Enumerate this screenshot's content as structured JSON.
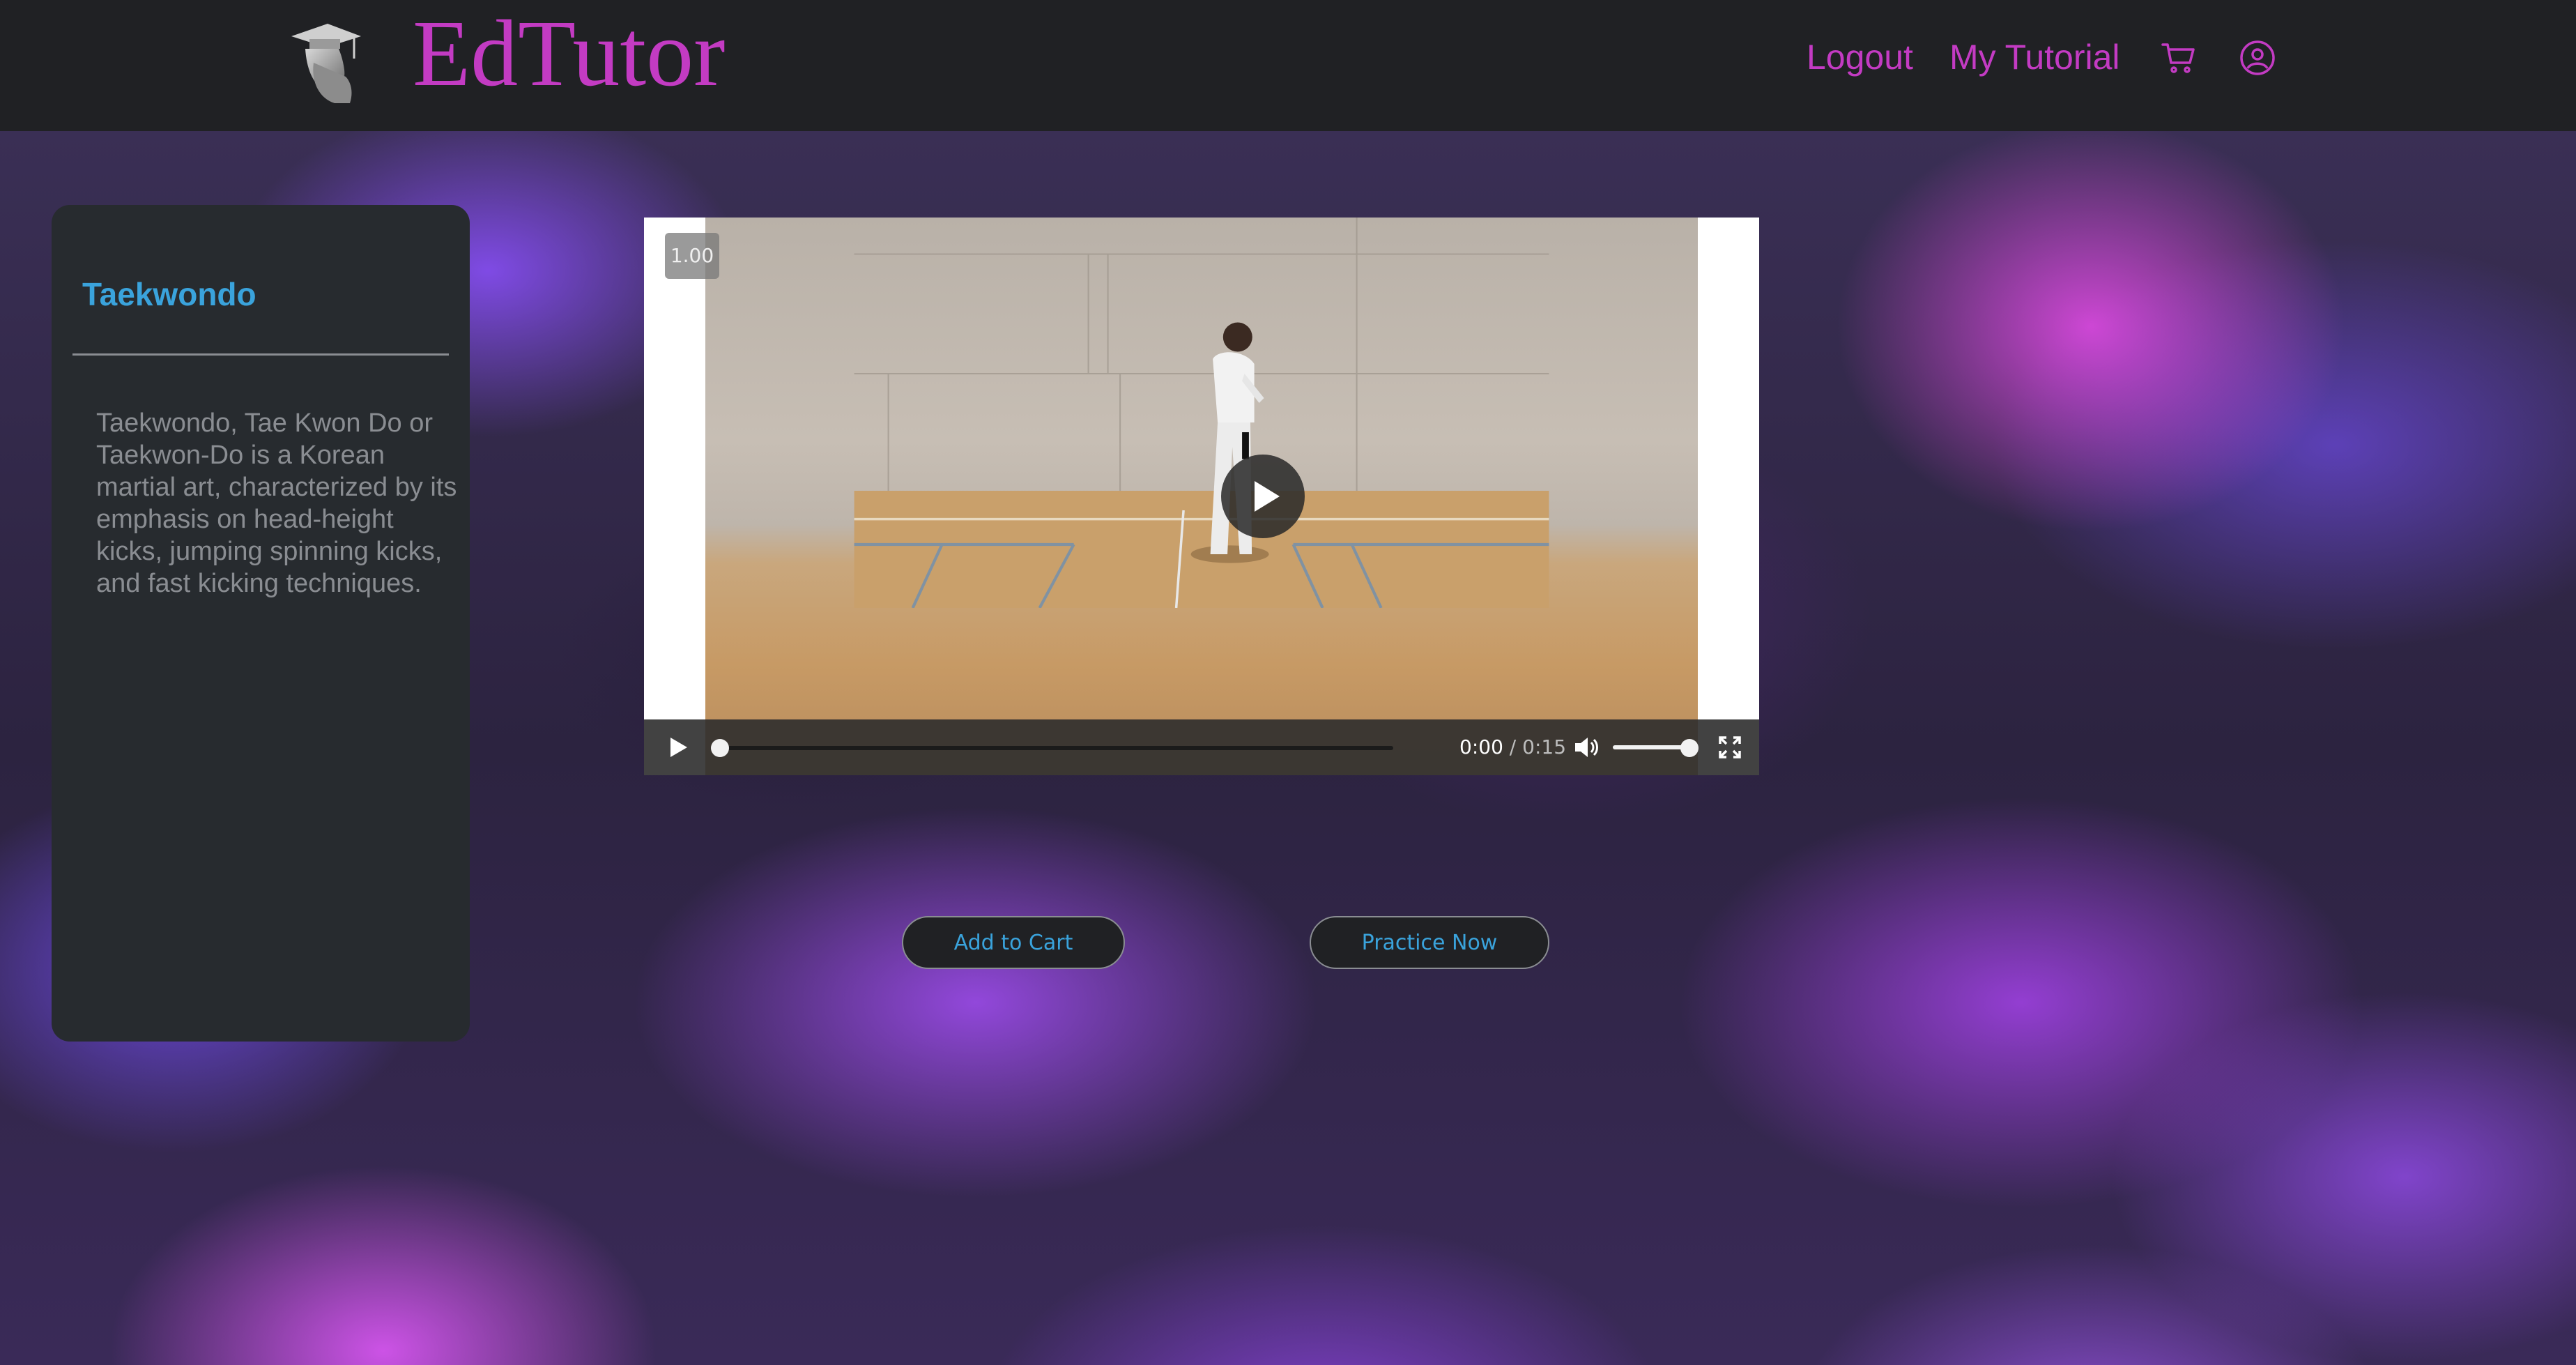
{
  "header": {
    "brand": "EdTutor",
    "logo_icon": "graduate-bust-icon",
    "nav": {
      "logout_label": "Logout",
      "tutorial_label": "My Tutorial",
      "cart_icon": "shopping-cart-icon",
      "user_icon": "user-circle-icon"
    }
  },
  "sidebar": {
    "title": "Taekwondo",
    "description": "Taekwondo, Tae Kwon Do or Taekwon-Do is a Korean martial art, characterized by its emphasis on head-height kicks, jumping spinning kicks, and fast kicking techniques."
  },
  "player": {
    "speed": "1.00",
    "time_current": "0:00",
    "time_separator": " / ",
    "time_total": "0:15",
    "progress": 0,
    "volume": 1
  },
  "actions": {
    "add_to_cart_label": "Add to Cart",
    "practice_label": "Practice Now"
  },
  "colors": {
    "brand": "#c33bc3",
    "accent": "#3aa3dc",
    "header_bg": "#202124",
    "sidebar_bg": "#272b2f"
  }
}
